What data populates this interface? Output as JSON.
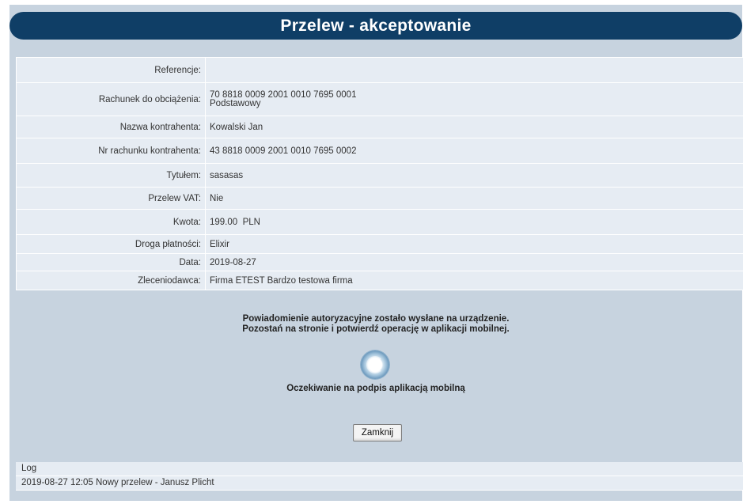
{
  "window": {
    "title": "Przelew - akceptowanie"
  },
  "details": [
    {
      "label": "Referencje:",
      "value": ""
    },
    {
      "label": "Rachunek do obciążenia:",
      "value": "70 8818 0009 2001 0010 7695 0001",
      "sub": "Podstawowy"
    },
    {
      "label": "Nazwa kontrahenta:",
      "value": "Kowalski Jan"
    },
    {
      "label": "Nr rachunku kontrahenta:",
      "value": "43 8818 0009 2001 0010 7695 0002"
    },
    {
      "label": "Tytułem:",
      "value": "sasasas"
    },
    {
      "label": "Przelew VAT:",
      "value": "Nie"
    },
    {
      "label": "Kwota:",
      "value": "199.00  PLN"
    },
    {
      "label": "Droga płatności:",
      "value": "Elixir"
    },
    {
      "label": "Data:",
      "value": "2019-08-27"
    },
    {
      "label": "Zleceniodawca:",
      "value": "Firma ETEST Bardzo testowa firma"
    }
  ],
  "notification": {
    "line1": "Powiadomienie autoryzacyjne zostało wysłane na urządzenie.",
    "line2": "Pozostań na stronie i potwierdź operację w aplikacji mobilnej.",
    "waiting": "Oczekiwanie na podpis aplikacją mobilną",
    "spinner_icon": "loading-spinner-icon"
  },
  "actions": {
    "close_label": "Zamknij"
  },
  "log": {
    "header": "Log",
    "entries": [
      "2019-08-27 12:05 Nowy przelew - Janusz Plicht"
    ]
  },
  "colors": {
    "title_bar": "#0f3e66",
    "panel": "#c7d3df",
    "table_bg": "#e6ecf3"
  }
}
